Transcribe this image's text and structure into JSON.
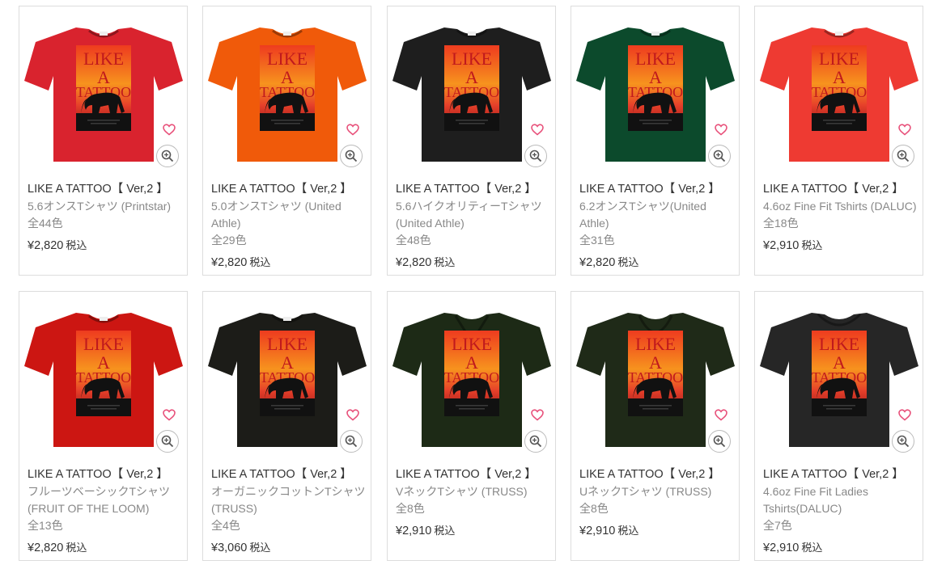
{
  "products": [
    {
      "title": "LIKE A TATTOO【 Ver,2 】",
      "desc": "5.6オンスTシャツ (Printstar)",
      "colors": "全44色",
      "price": "¥2,820",
      "tax": "税込",
      "shirt_color": "#d9232e",
      "neck": "crew"
    },
    {
      "title": "LIKE A TATTOO【 Ver,2 】",
      "desc": "5.0オンスTシャツ (United Athle)",
      "colors": "全29色",
      "price": "¥2,820",
      "tax": "税込",
      "shirt_color": "#f05a0a",
      "neck": "crew"
    },
    {
      "title": "LIKE A TATTOO【 Ver,2 】",
      "desc": "5.6ハイクオリティーTシャツ (United Athle)",
      "colors": "全48色",
      "price": "¥2,820",
      "tax": "税込",
      "shirt_color": "#1e1e1e",
      "neck": "crew"
    },
    {
      "title": "LIKE A TATTOO【 Ver,2 】",
      "desc": "6.2オンスTシャツ(United Athle)",
      "colors": "全31色",
      "price": "¥2,820",
      "tax": "税込",
      "shirt_color": "#0c4a2c",
      "neck": "crew"
    },
    {
      "title": "LIKE A TATTOO【 Ver,2 】",
      "desc": "4.6oz Fine Fit Tshirts (DALUC)",
      "colors": "全18色",
      "price": "¥2,910",
      "tax": "税込",
      "shirt_color": "#ee3a32",
      "neck": "crew"
    },
    {
      "title": "LIKE A TATTOO【 Ver,2 】",
      "desc": "フルーツベーシックTシャツ (FRUIT OF THE LOOM)",
      "colors": "全13色",
      "price": "¥2,820",
      "tax": "税込",
      "shirt_color": "#cc1612",
      "neck": "crew"
    },
    {
      "title": "LIKE A TATTOO【 Ver,2 】",
      "desc": "オーガニックコットンTシャツ (TRUSS)",
      "colors": "全4色",
      "price": "¥3,060",
      "tax": "税込",
      "shirt_color": "#1c1c18",
      "neck": "crew"
    },
    {
      "title": "LIKE A TATTOO【 Ver,2 】",
      "desc": "VネックTシャツ (TRUSS)",
      "colors": "全8色",
      "price": "¥2,910",
      "tax": "税込",
      "shirt_color": "#1d2a16",
      "neck": "v"
    },
    {
      "title": "LIKE A TATTOO【 Ver,2 】",
      "desc": "UネックTシャツ (TRUSS)",
      "colors": "全8色",
      "price": "¥2,910",
      "tax": "税込",
      "shirt_color": "#1f2a18",
      "neck": "u"
    },
    {
      "title": "LIKE A TATTOO【 Ver,2 】",
      "desc": "4.6oz Fine Fit Ladies Tshirts(DALUC)",
      "colors": "全7色",
      "price": "¥2,910",
      "tax": "税込",
      "shirt_color": "#262626",
      "neck": "scoop"
    }
  ],
  "print": {
    "line1": "LIKE",
    "line2": "A",
    "line3": "TATTOO"
  },
  "icons": {
    "favorite": "heart-icon",
    "zoom": "zoom-in-icon"
  },
  "accent_color": "#e8507a"
}
